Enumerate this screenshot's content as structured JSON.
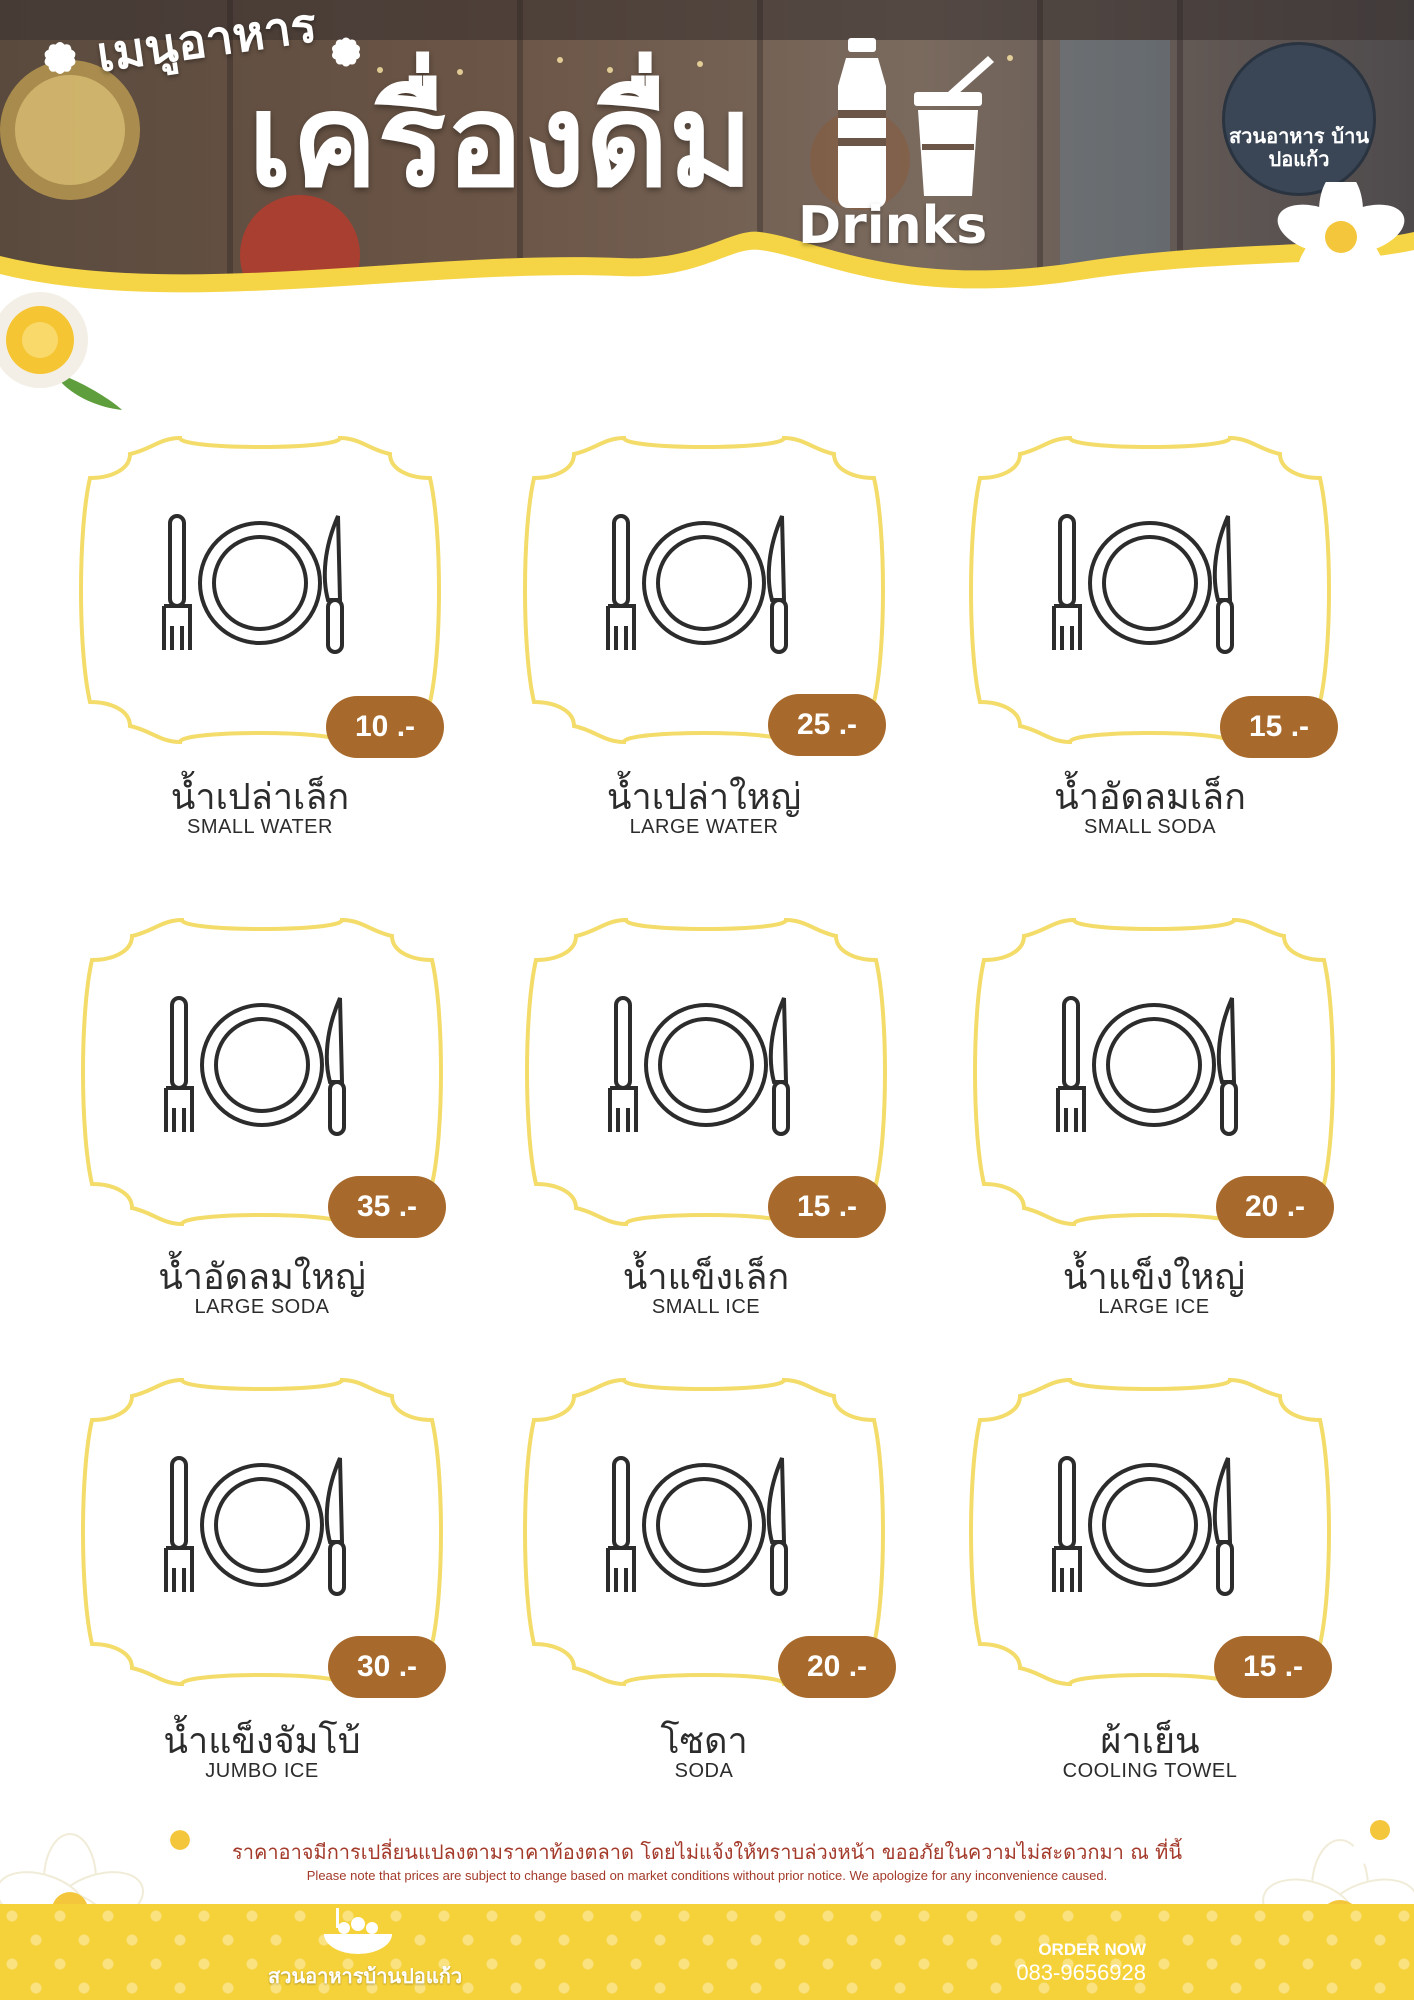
{
  "header": {
    "title_sub": "เมนูอาหาร",
    "title_main": "เครื่องดื่ม",
    "title_en": "Drinks",
    "logo_text": "สวนอาหาร บ้านปอแก้ว"
  },
  "colors": {
    "accent_yellow": "#f6d23a",
    "frame_yellow": "#f3dc6a",
    "price_brown": "#a86a2c",
    "note_red": "#a33a2a"
  },
  "items": [
    {
      "price": "10 .-",
      "name_th": "น้ำเปล่าเล็ก",
      "name_en": "SMALL WATER"
    },
    {
      "price": "25 .-",
      "name_th": "น้ำเปล่าใหญ่",
      "name_en": "LARGE WATER"
    },
    {
      "price": "15 .-",
      "name_th": "น้ำอัดลมเล็ก",
      "name_en": "SMALL SODA"
    },
    {
      "price": "35 .-",
      "name_th": "น้ำอัดลมใหญ่",
      "name_en": "LARGE SODA"
    },
    {
      "price": "15 .-",
      "name_th": "น้ำแข็งเล็ก",
      "name_en": "SMALL ICE"
    },
    {
      "price": "20 .-",
      "name_th": "น้ำแข็งใหญ่",
      "name_en": "LARGE ICE"
    },
    {
      "price": "30 .-",
      "name_th": "น้ำแข็งจัมโบ้",
      "name_en": "JUMBO ICE"
    },
    {
      "price": "20 .-",
      "name_th": "โซดา",
      "name_en": "SODA"
    },
    {
      "price": "15 .-",
      "name_th": "ผ้าเย็น",
      "name_en": "COOLING TOWEL"
    }
  ],
  "footer": {
    "note_th": "ราคาอาจมีการเปลี่ยนแปลงตามราคาท้องตลาด โดยไม่แจ้งให้ทราบล่วงหน้า ขออภัยในความไม่สะดวกมา ณ ที่นี้",
    "note_en": "Please note that prices are subject to change based on market conditions without prior notice. We apologize for any inconvenience caused.",
    "brand": "สวนอาหารบ้านปอแก้ว",
    "order_label": "ORDER NOW",
    "phone": "083-9656928"
  }
}
